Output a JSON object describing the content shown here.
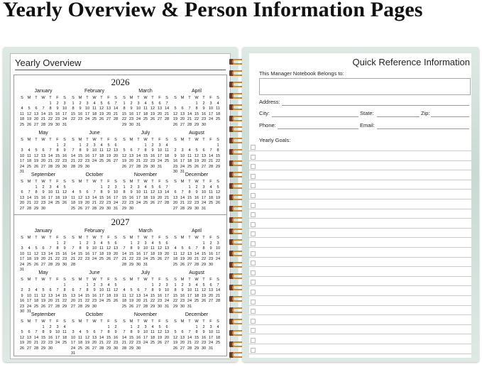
{
  "banner": {
    "title": "Yearly Overview & Person Information Pages"
  },
  "left_page": {
    "title": "Yearly Overview",
    "years": [
      {
        "year": "2026",
        "months": [
          {
            "name": "January",
            "lead": 4,
            "days": 31
          },
          {
            "name": "February",
            "lead": 0,
            "days": 28
          },
          {
            "name": "March",
            "lead": 0,
            "days": 31
          },
          {
            "name": "April",
            "lead": 3,
            "days": 30
          },
          {
            "name": "May",
            "lead": 5,
            "days": 31
          },
          {
            "name": "June",
            "lead": 1,
            "days": 30
          },
          {
            "name": "July",
            "lead": 3,
            "days": 31
          },
          {
            "name": "August",
            "lead": 6,
            "days": 31
          },
          {
            "name": "September",
            "lead": 2,
            "days": 30
          },
          {
            "name": "October",
            "lead": 4,
            "days": 31
          },
          {
            "name": "November",
            "lead": 0,
            "days": 30
          },
          {
            "name": "December",
            "lead": 2,
            "days": 31
          }
        ]
      },
      {
        "year": "2027",
        "months": [
          {
            "name": "January",
            "lead": 5,
            "days": 31
          },
          {
            "name": "February",
            "lead": 1,
            "days": 28
          },
          {
            "name": "March",
            "lead": 1,
            "days": 31
          },
          {
            "name": "April",
            "lead": 4,
            "days": 30
          },
          {
            "name": "May",
            "lead": 6,
            "days": 31
          },
          {
            "name": "June",
            "lead": 2,
            "days": 30
          },
          {
            "name": "July",
            "lead": 4,
            "days": 31
          },
          {
            "name": "August",
            "lead": 0,
            "days": 31
          },
          {
            "name": "September",
            "lead": 3,
            "days": 30
          },
          {
            "name": "October",
            "lead": 5,
            "days": 31
          },
          {
            "name": "November",
            "lead": 1,
            "days": 30
          },
          {
            "name": "December",
            "lead": 3,
            "days": 31
          }
        ]
      }
    ],
    "weekday_letters": [
      "S",
      "M",
      "T",
      "W",
      "T",
      "F",
      "S"
    ]
  },
  "right_page": {
    "title": "Quick Reference Information",
    "belongs_label": "This Manager Notebook Belongs to:",
    "address_label": "Address:",
    "city_label": "City:",
    "state_label": "State:",
    "zip_label": "Zip:",
    "phone_label": "Phone:",
    "email_label": "Email:",
    "goals_label": "Yearly Goals:",
    "goal_rows": 22
  },
  "colors": {
    "cover_accent": "#c9d9d2",
    "spiral_wire": "#c98a3a",
    "spiral_hole": "#6b3b2a"
  }
}
